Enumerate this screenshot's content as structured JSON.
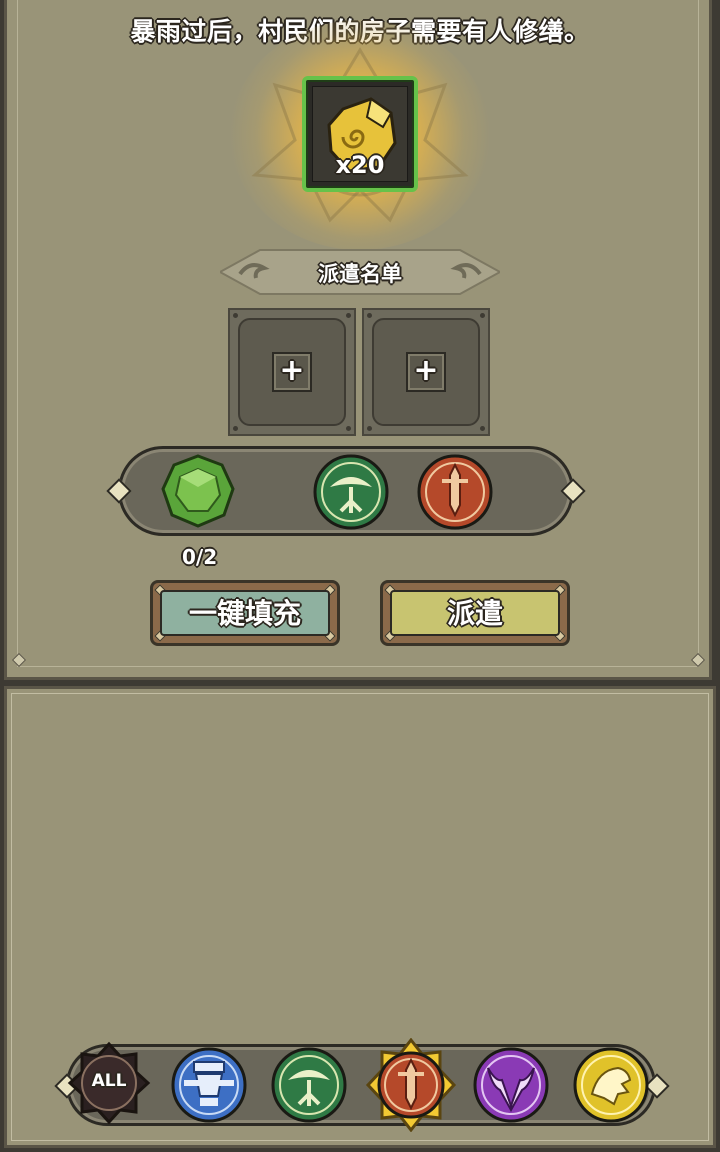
{
  "quest": {
    "description": "暴雨过后，村民们的房子需要有人修缮。",
    "reward": {
      "icon": "gold-ore-icon",
      "count_label": "x20",
      "frame_color": "#66c24a"
    }
  },
  "dispatch": {
    "title": "派遣名单",
    "slots": [
      {
        "plus_label": "+"
      },
      {
        "plus_label": "+"
      }
    ],
    "requirements": [
      {
        "icon": "green-gem-icon",
        "color": "#5aa53a"
      },
      {
        "icon": "tree-faction-icon",
        "color": "#2f7a45"
      },
      {
        "icon": "sword-faction-icon",
        "color": "#b5492a"
      }
    ],
    "progress": "0/2",
    "autofill_label": "一键填充",
    "dispatch_label": "派遣"
  },
  "filters": [
    {
      "name": "filter-all",
      "label": "ALL",
      "icon": "all-icon",
      "color": "#3a2a2a",
      "selected": false
    },
    {
      "name": "filter-knight",
      "label": "",
      "icon": "knight-faction-icon",
      "color": "#3d6fc4",
      "selected": false
    },
    {
      "name": "filter-tree",
      "label": "",
      "icon": "tree-faction-icon",
      "color": "#2f7a45",
      "selected": false
    },
    {
      "name": "filter-sword",
      "label": "",
      "icon": "sword-faction-icon",
      "color": "#b5492a",
      "selected": true
    },
    {
      "name": "filter-demon",
      "label": "",
      "icon": "demon-faction-icon",
      "color": "#8a3ab5",
      "selected": false
    },
    {
      "name": "filter-lion",
      "label": "",
      "icon": "lion-faction-icon",
      "color": "#e0c22a",
      "selected": false
    }
  ]
}
